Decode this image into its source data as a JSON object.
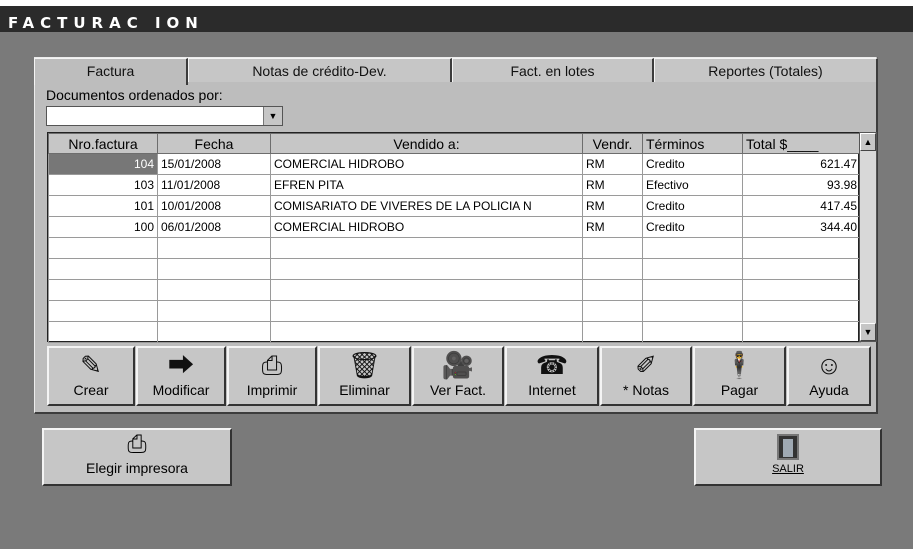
{
  "window": {
    "title": "FACTURAC ION"
  },
  "tabs": [
    {
      "label": "Factura",
      "active": true
    },
    {
      "label": "Notas de crédito-Dev.",
      "active": false
    },
    {
      "label": "Fact. en lotes",
      "active": false
    },
    {
      "label": "Reportes (Totales)",
      "active": false
    }
  ],
  "sort": {
    "label": "Documentos ordenados por:",
    "value": ""
  },
  "table": {
    "headers": [
      "Nro.factura",
      "Fecha",
      "Vendido a:",
      "Vendr.",
      "Términos",
      "Total $____"
    ],
    "rows": [
      [
        "104",
        "15/01/2008",
        "COMERCIAL HIDROBO",
        "RM",
        "Credito",
        "621.47"
      ],
      [
        "103",
        "11/01/2008",
        "EFREN PITA",
        "RM",
        "Efectivo",
        "93.98"
      ],
      [
        "101",
        "10/01/2008",
        "COMISARIATO DE VIVERES DE LA POLICIA N",
        "RM",
        "Credito",
        "417.45"
      ],
      [
        "100",
        "06/01/2008",
        "COMERCIAL HIDROBO",
        "RM",
        "Credito",
        "344.40"
      ]
    ]
  },
  "toolbar": [
    {
      "label": "Crear",
      "icon": "glue-bottle-icon"
    },
    {
      "label": "Modificar",
      "icon": "arrow-sign-icon"
    },
    {
      "label": "Imprimir",
      "icon": "printer-icon"
    },
    {
      "label": "Eliminar",
      "icon": "trash-can-icon"
    },
    {
      "label": "Ver Fact.",
      "icon": "video-camera-icon"
    },
    {
      "label": "Internet",
      "icon": "telephone-icon"
    },
    {
      "label": "* Notas",
      "icon": "notepad-icon"
    },
    {
      "label": "Pagar",
      "icon": "waiter-icon"
    },
    {
      "label": "Ayuda",
      "icon": "smiley-icon"
    }
  ],
  "bottom": {
    "printer_label": "Elegir impresora",
    "exit_label": "SALIR"
  },
  "colors": {
    "titlebar": "#2b2b2b",
    "background": "#7a7a7a",
    "panel": "#bdbdbd",
    "selected_cell": "#777777"
  }
}
